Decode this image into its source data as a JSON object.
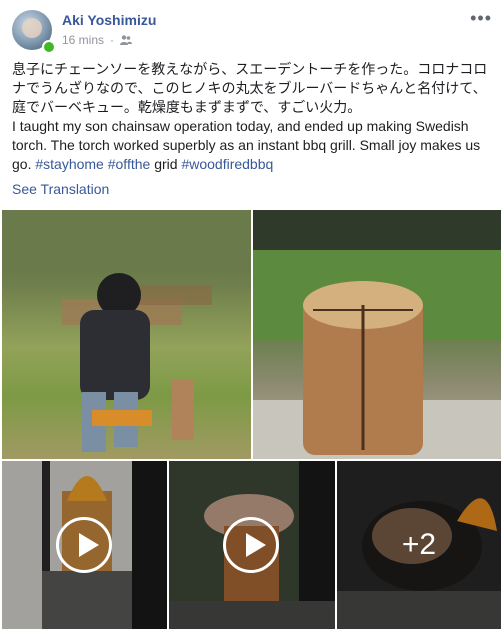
{
  "post": {
    "author": "Aki Yoshimizu",
    "time": "16 mins",
    "audience_icon": "friends-icon",
    "more_icon": "more-options-icon",
    "text_ja_1": "息子にチェーンソーを教えながら、スエーデントーチを作った。コロナコロナでうんざりなので、このヒノキの丸太をブルーバードちゃんと名付けて、",
    "text_ja_2": "庭でバーベキュー。乾燥度もまずまずで、すごい火力。",
    "text_en": "I taught my son chainsaw operation today, and ended up making Swedish torch. The torch worked superbly as an instant bbq grill. Small joy makes us go. ",
    "hashtags": [
      "#stayhome",
      "#offthe",
      "grid",
      "#woodfiredbbq"
    ],
    "see_translation": "See Translation"
  },
  "media": {
    "more_count": "+2",
    "items": [
      {
        "kind": "photo",
        "desc": "boy-chainsaw-photo"
      },
      {
        "kind": "photo",
        "desc": "log-photo"
      },
      {
        "kind": "video",
        "desc": "torch-video-1"
      },
      {
        "kind": "video",
        "desc": "torch-video-2"
      },
      {
        "kind": "photo",
        "desc": "grill-photo-more"
      }
    ]
  },
  "colors": {
    "link": "#385898",
    "meta": "#90949c",
    "online": "#42b72a"
  }
}
